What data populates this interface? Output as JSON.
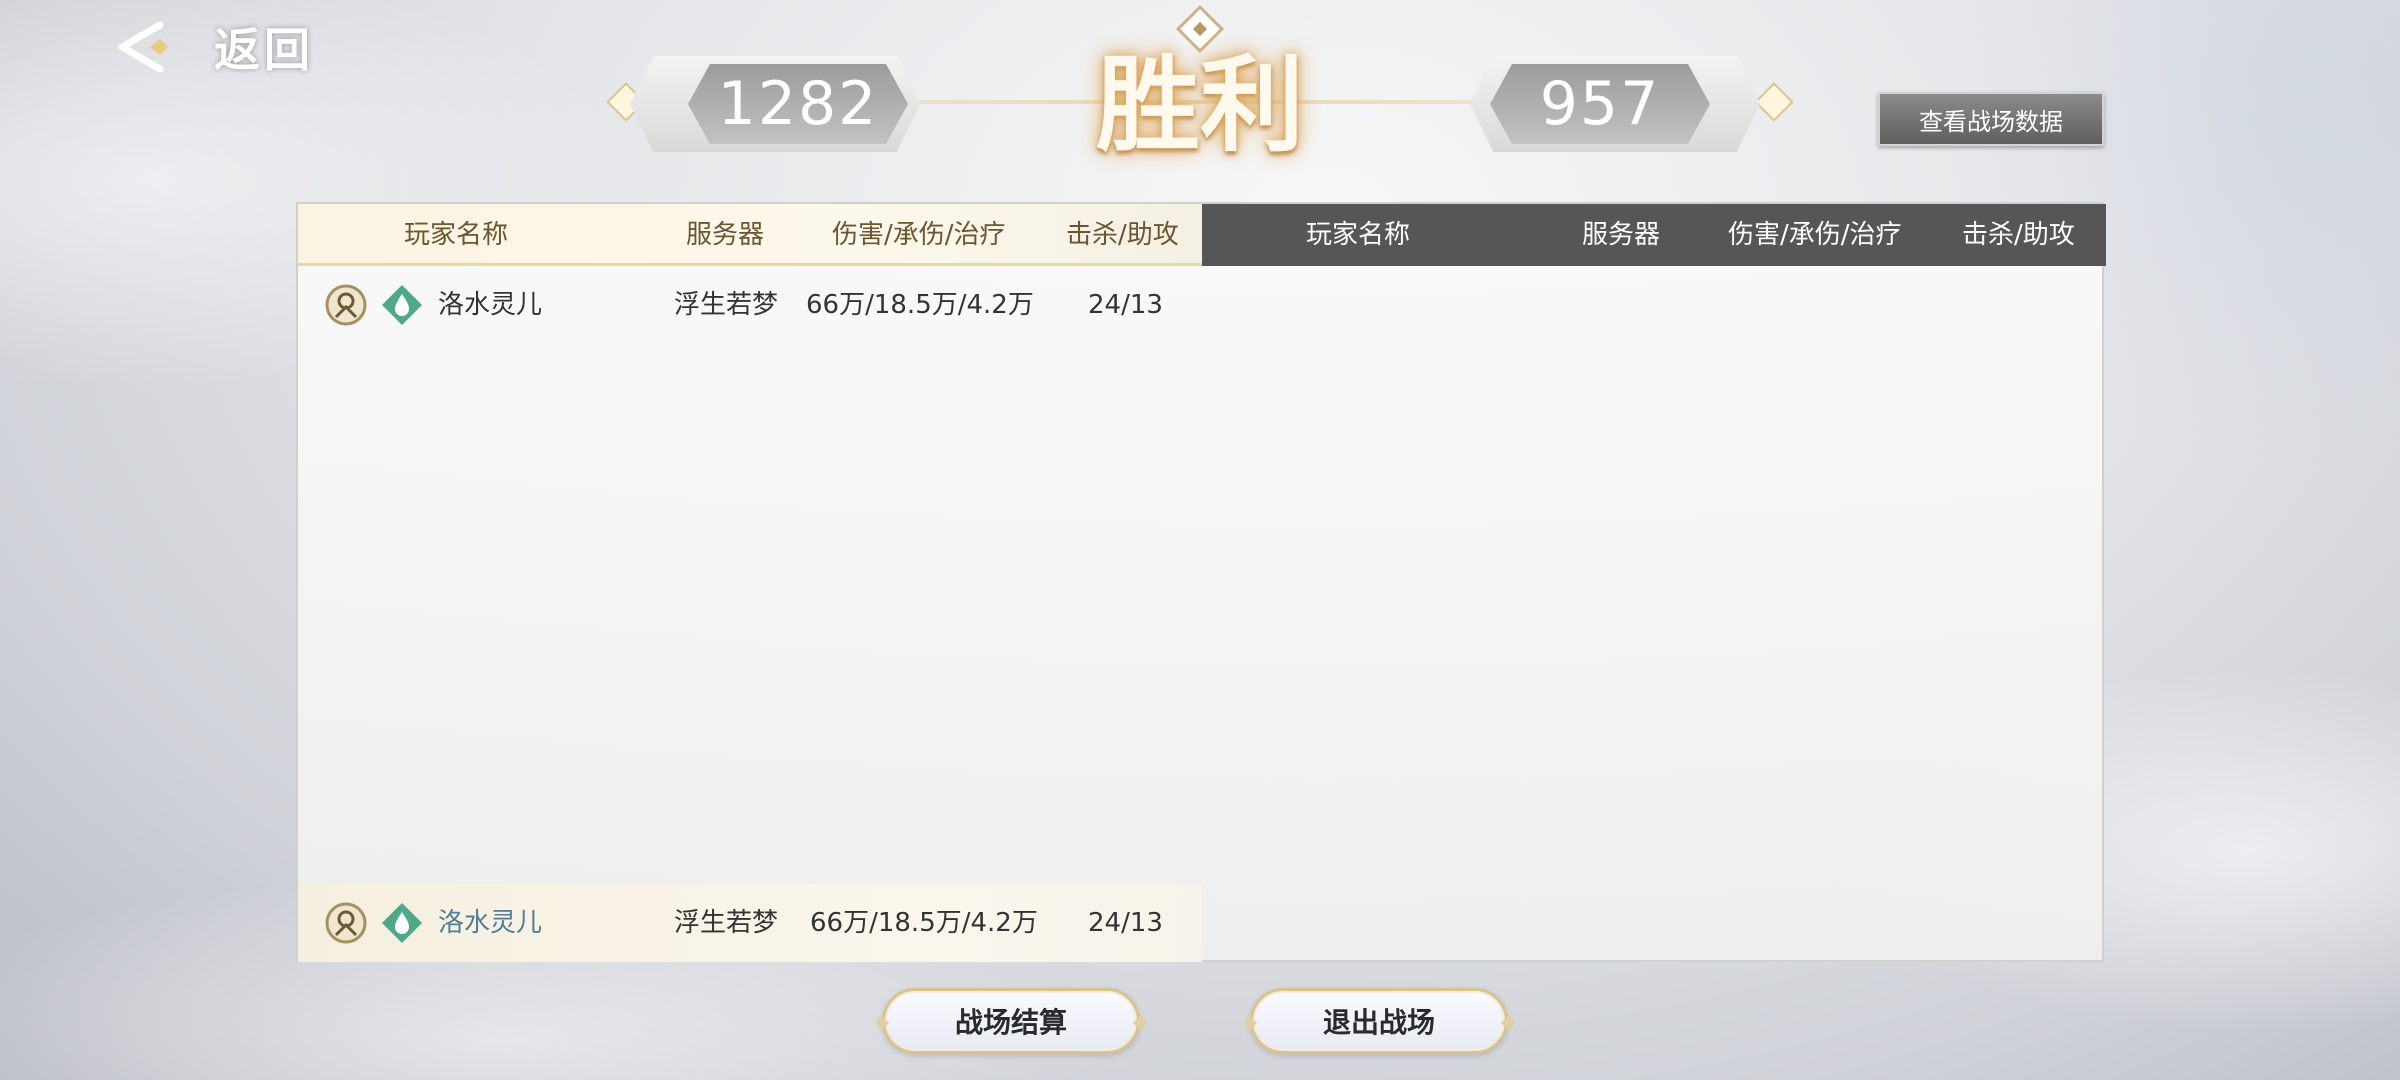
{
  "nav": {
    "back_label": "返回"
  },
  "banner": {
    "result": "胜利",
    "score_left": "1282",
    "score_right": "957"
  },
  "view_data_button": "查看战场数据",
  "table": {
    "columns_left": [
      "玩家名称",
      "服务器",
      "伤害/承伤/治疗",
      "击杀/助攻"
    ],
    "columns_right": [
      "玩家名称",
      "服务器",
      "伤害/承伤/治疗",
      "击杀/助攻"
    ],
    "left_rows": [
      {
        "name": "洛水灵儿",
        "server": "浮生若梦",
        "stats": "66万/18.5万/4.2万",
        "kills": "24/13"
      }
    ],
    "self_row": {
      "name": "洛水灵儿",
      "server": "浮生若梦",
      "stats": "66万/18.5万/4.2万",
      "kills": "24/13"
    }
  },
  "buttons": {
    "settle": "战场结算",
    "exit": "退出战场"
  },
  "colors": {
    "accent_gold": "#d7c38e",
    "header_dark": "#565656",
    "self_name": "#4f7f96",
    "class_icon": "#4fa88a"
  },
  "icons": {
    "back": "back-arrow-icon",
    "rank": "rank-emblem-icon",
    "class": "water-drop-class-icon"
  }
}
